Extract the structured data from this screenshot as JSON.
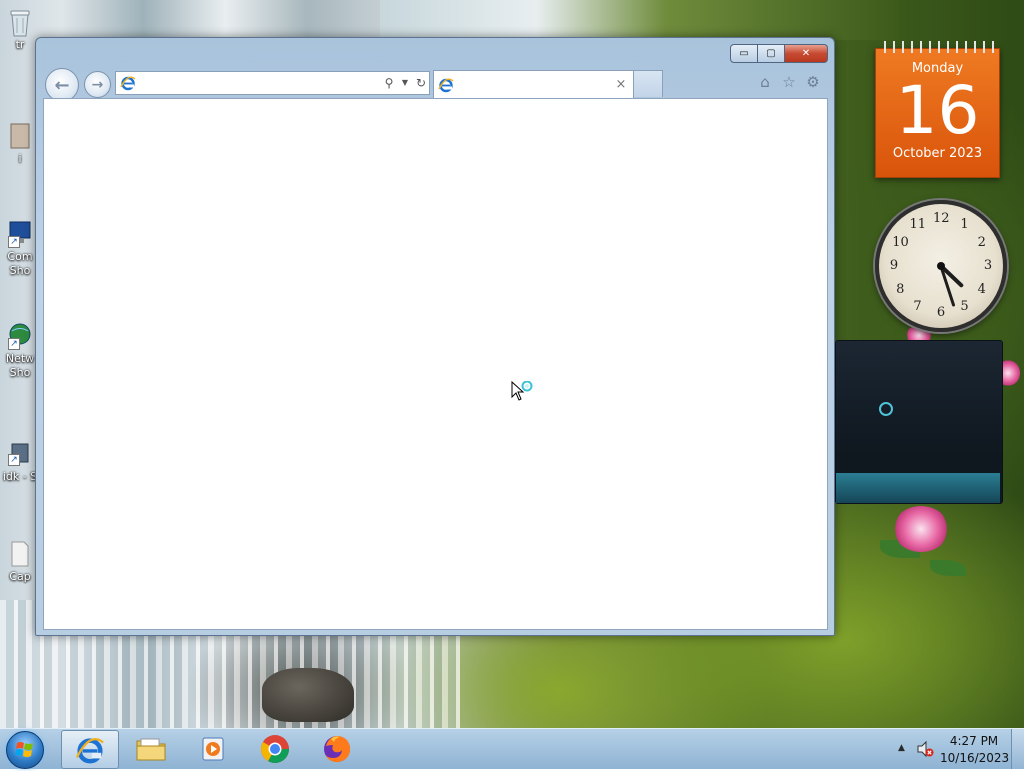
{
  "desktop": {
    "icons": [
      {
        "label": "tr"
      },
      {
        "label": "i"
      },
      {
        "label": "Com\nSho"
      },
      {
        "label": "Netw\nSho"
      },
      {
        "label": "idk - S"
      },
      {
        "label": "Cap"
      }
    ]
  },
  "browser": {
    "address": {
      "value": "",
      "placeholder": ""
    },
    "tab": {
      "title": "",
      "close_glyph": "×"
    },
    "window_buttons": {
      "minimize": "▭",
      "maximize": "▢",
      "close": "✕"
    },
    "toolbar": {
      "home_icon": "⌂",
      "favorites_icon": "☆",
      "tools_icon": "⚙"
    }
  },
  "gadgets": {
    "calendar": {
      "weekday": "Monday",
      "day": "16",
      "month_year": "October 2023"
    },
    "clock": {
      "hour": 4,
      "minute": 27,
      "numerals": [
        "12",
        "1",
        "2",
        "3",
        "4",
        "5",
        "6",
        "7",
        "8",
        "9",
        "10",
        "11"
      ]
    }
  },
  "taskbar": {
    "pinned": [
      {
        "name": "internet-explorer",
        "active": true
      },
      {
        "name": "windows-explorer",
        "active": false
      },
      {
        "name": "media-player",
        "active": false
      },
      {
        "name": "google-chrome",
        "active": false
      },
      {
        "name": "firefox",
        "active": false
      }
    ],
    "tray": {
      "time": "4:27 PM",
      "date": "10/16/2023",
      "show_hidden_glyph": "▲"
    }
  },
  "colors": {
    "calendar_orange": "#e6640f",
    "ie_blue": "#1e73d2",
    "window_frame": "#b7cde2"
  }
}
